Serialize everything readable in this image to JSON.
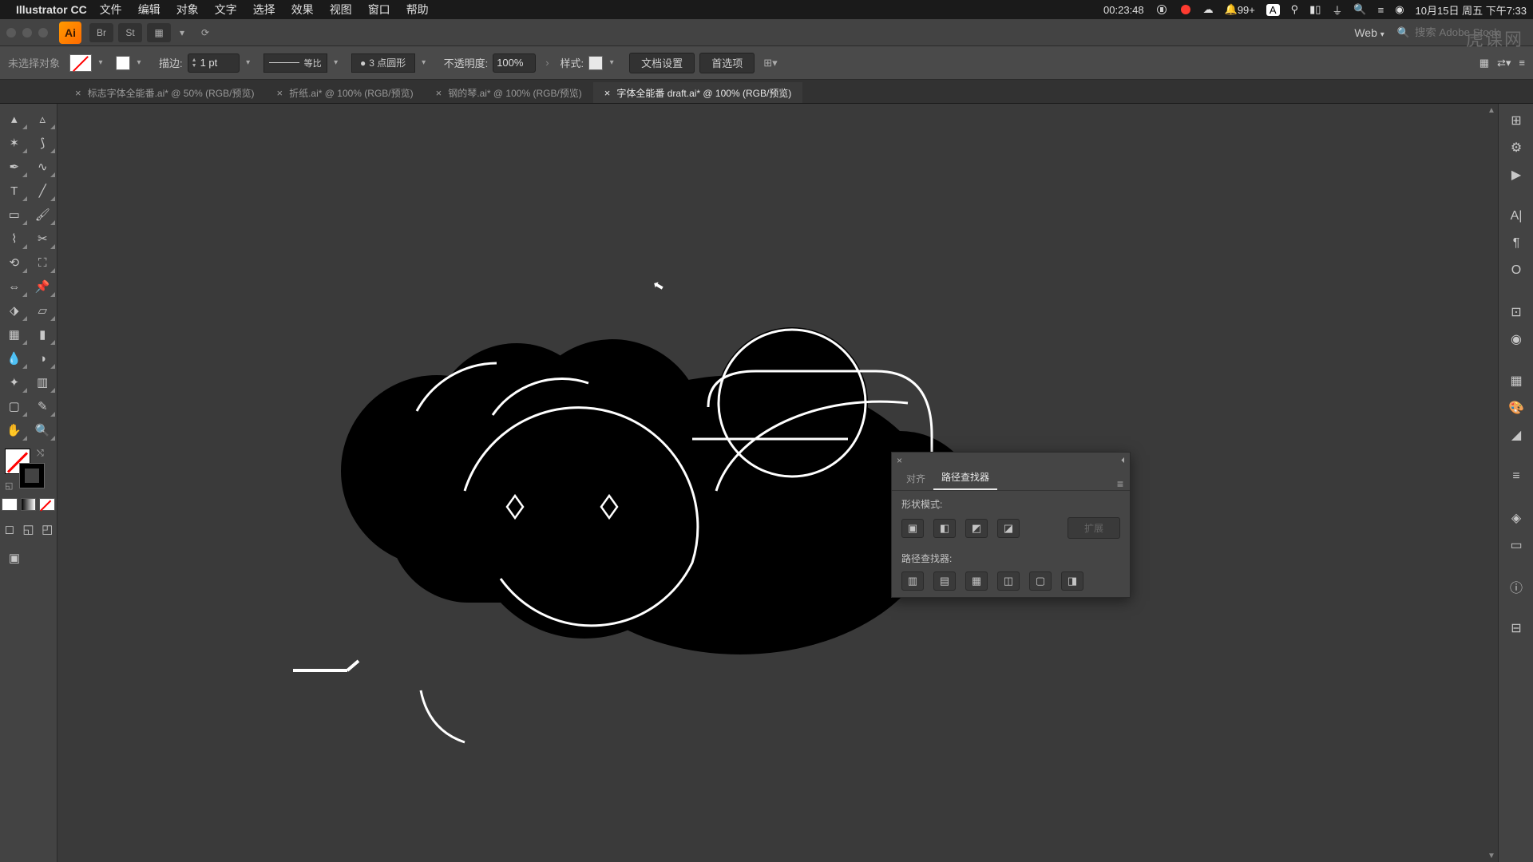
{
  "menubar": {
    "app_name": "Illustrator CC",
    "items": [
      "文件",
      "编辑",
      "对象",
      "文字",
      "选择",
      "效果",
      "视图",
      "窗口",
      "帮助"
    ],
    "timer": "00:23:48",
    "notif_count": "99+",
    "input_mode": "A",
    "date_time": "10月15日 周五 下午7:33"
  },
  "appbar": {
    "logo_text": "Ai",
    "web_label": "Web",
    "search_placeholder": "搜索 Adobe Stock"
  },
  "watermark": "虎课网",
  "control": {
    "selection_label": "未选择对象",
    "stroke_label": "描边:",
    "stroke_weight": "1 pt",
    "stroke_style": "等比",
    "brush_profile": "3 点圆形",
    "opacity_label": "不透明度:",
    "opacity_value": "100%",
    "style_label": "样式:",
    "doc_setup": "文档设置",
    "prefs": "首选项"
  },
  "tabs": [
    {
      "label": "标志字体全能番.ai* @ 50% (RGB/预览)",
      "active": false
    },
    {
      "label": "折纸.ai* @ 100% (RGB/预览)",
      "active": false
    },
    {
      "label": "钢的琴.ai* @ 100% (RGB/预览)",
      "active": false
    },
    {
      "label": "字体全能番 draft.ai* @ 100% (RGB/预览)",
      "active": true
    }
  ],
  "pathfinder": {
    "tab_align": "对齐",
    "tab_pathfinder": "路径查找器",
    "shape_modes_label": "形状模式:",
    "expand_label": "扩展",
    "pathfinders_label": "路径查找器:"
  }
}
